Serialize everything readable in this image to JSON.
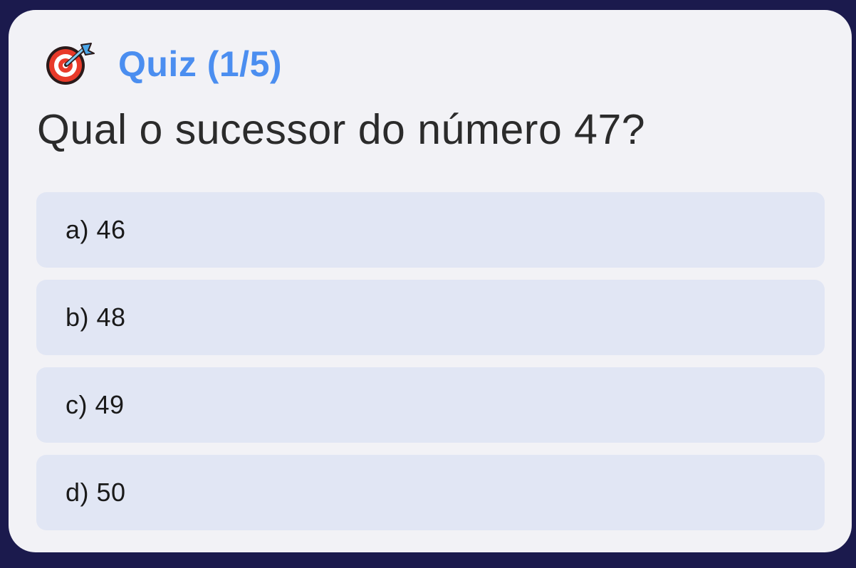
{
  "quiz": {
    "title": "Quiz (1/5)",
    "question": "Qual o sucessor do número 47?",
    "icon": "target-dart-icon",
    "accent_color": "#4b8ef0"
  },
  "options": [
    {
      "label": "a) 46"
    },
    {
      "label": "b) 48"
    },
    {
      "label": "c) 49"
    },
    {
      "label": "d) 50"
    }
  ]
}
